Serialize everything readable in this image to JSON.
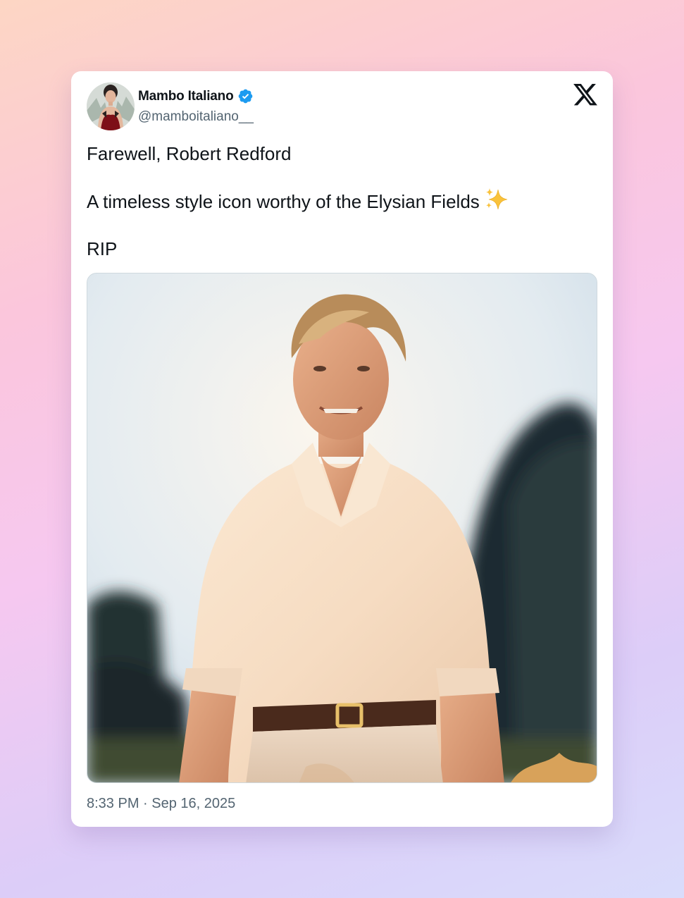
{
  "tweet": {
    "author": {
      "display_name": "Mambo Italiano",
      "handle": "@mamboitaliano__",
      "verified": true,
      "avatar_icon": "profile-avatar"
    },
    "brand_icon": "x-logo-icon",
    "paragraphs": [
      "Farewell, Robert Redford",
      "A timeless style icon worthy of the Elysian Fields",
      "RIP"
    ],
    "emoji": "sparkles-icon",
    "timestamp": "8:33 PM · Sep 16, 2025",
    "colors": {
      "verified_badge": "#1d9bf0",
      "text_primary": "#0f1419",
      "text_secondary": "#536471",
      "card_bg": "#ffffff"
    }
  }
}
